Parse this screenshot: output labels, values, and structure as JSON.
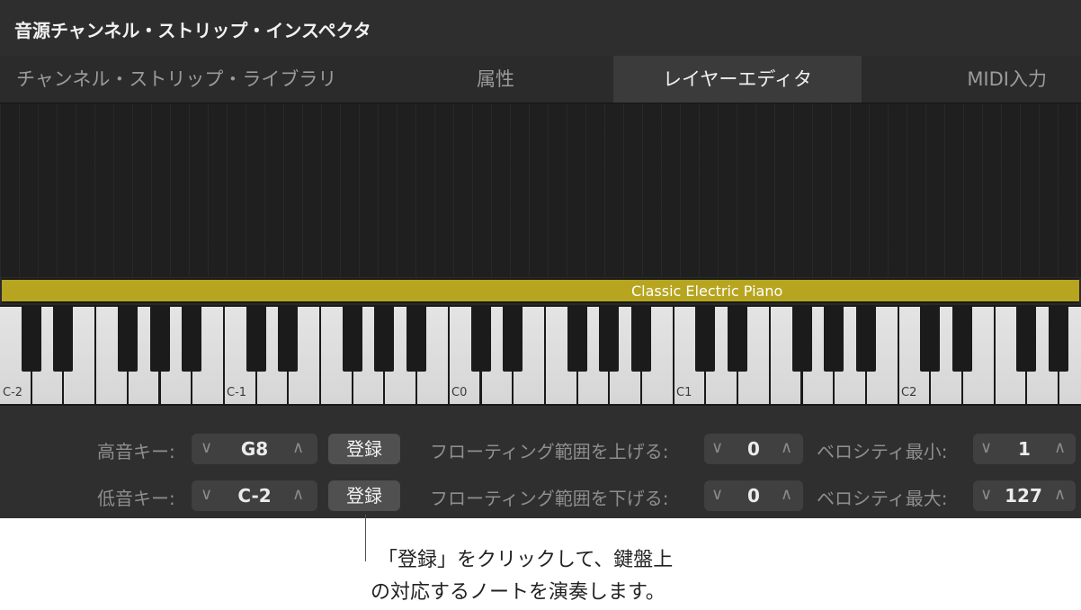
{
  "window": {
    "title": "音源チャンネル・ストリップ・インスペクタ"
  },
  "tabs": [
    {
      "label": "チャンネル・ストリップ・ライブラリ",
      "selected": false
    },
    {
      "label": "属性",
      "selected": false
    },
    {
      "label": "レイヤーエディタ",
      "selected": true
    },
    {
      "label": "MIDI入力",
      "selected": false
    }
  ],
  "layer": {
    "name": "Classic Electric Piano",
    "color": "#b7a51f"
  },
  "keyboard": {
    "octave_labels": [
      "C-2",
      "C-1",
      "C0",
      "C1",
      "C2"
    ]
  },
  "controls": {
    "high_key": {
      "label": "高音キー:",
      "value": "G8",
      "learn": "登録"
    },
    "low_key": {
      "label": "低音キー:",
      "value": "C-2",
      "learn": "登録"
    },
    "float_up": {
      "label": "フローティング範囲を上げる:",
      "value": "0"
    },
    "float_down": {
      "label": "フローティング範囲を下げる:",
      "value": "0"
    },
    "vel_min": {
      "label": "ベロシティ最小:",
      "value": "1"
    },
    "vel_max": {
      "label": "ベロシティ最大:",
      "value": "127"
    },
    "chevron_down": "∨",
    "chevron_up": "∧"
  },
  "callout": {
    "line1": "「登録」をクリックして、鍵盤上",
    "line2": "の対応するノートを演奏します。"
  }
}
